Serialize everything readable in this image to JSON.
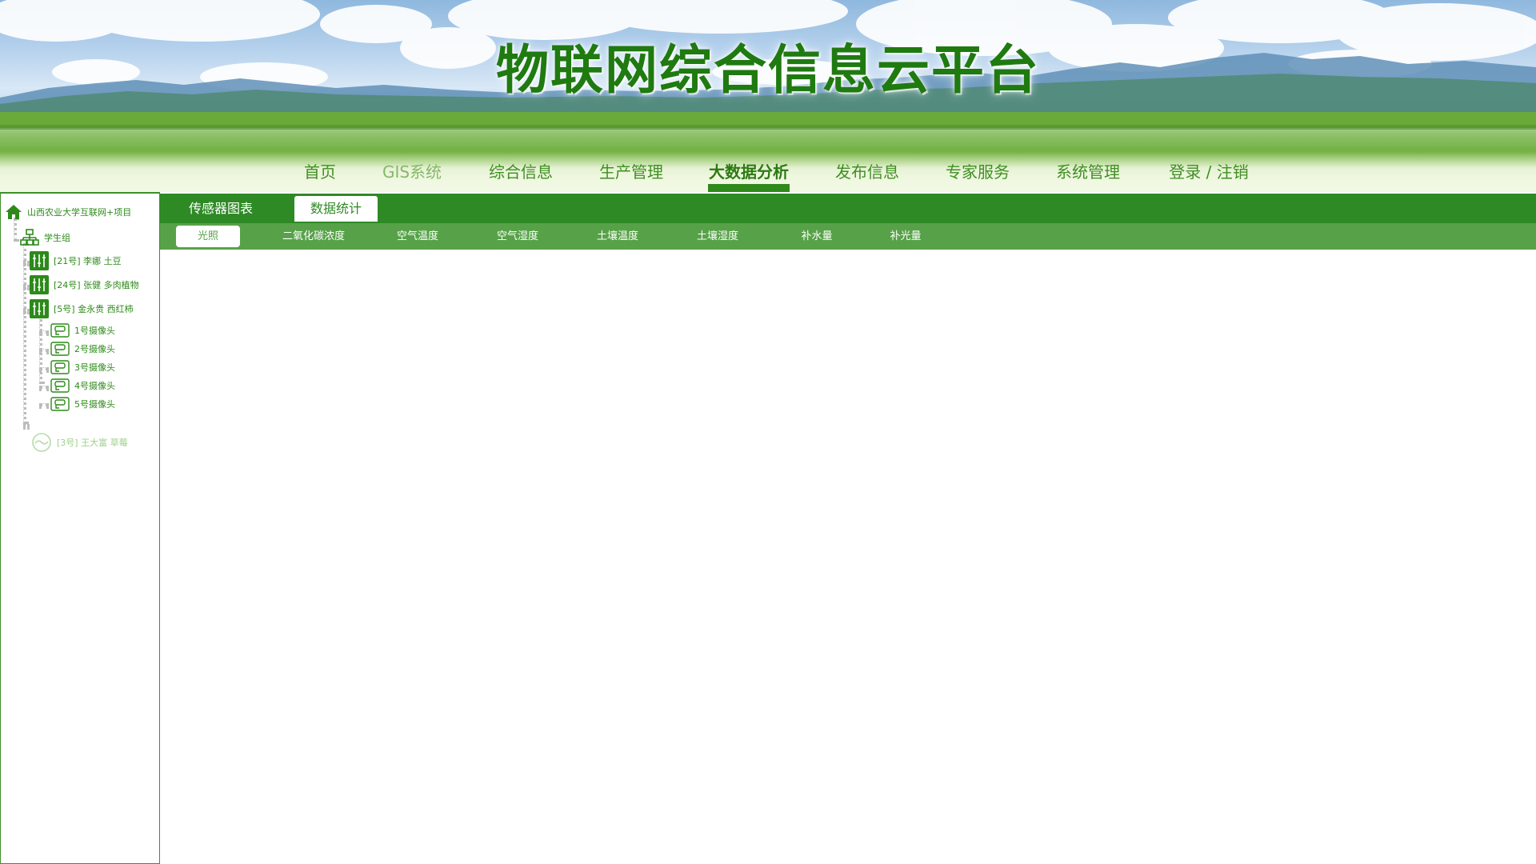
{
  "header": {
    "title": "物联网综合信息云平台"
  },
  "nav": {
    "items": [
      {
        "label": "首页"
      },
      {
        "label": "GIS系统"
      },
      {
        "label": "综合信息"
      },
      {
        "label": "生产管理"
      },
      {
        "label": "大数据分析"
      },
      {
        "label": "发布信息"
      },
      {
        "label": "专家服务"
      },
      {
        "label": "系统管理"
      },
      {
        "label": "登录 / 注销"
      }
    ],
    "active": "大数据分析"
  },
  "tree": {
    "root": "山西农业大学互联网+项目",
    "group": "学生组",
    "nodes": [
      {
        "label": "[21号] 李娜 土豆"
      },
      {
        "label": "[24号] 张健 多肉植物"
      },
      {
        "label": "[5号] 金永贵 西红柿"
      }
    ],
    "cameras": [
      {
        "label": "1号摄像头"
      },
      {
        "label": "2号摄像头"
      },
      {
        "label": "3号摄像头"
      },
      {
        "label": "4号摄像头"
      },
      {
        "label": "5号摄像头"
      }
    ],
    "offline_node": "[3号] 王大富 草莓"
  },
  "tabs_primary": {
    "items": [
      {
        "label": "传感器图表"
      },
      {
        "label": "数据统计"
      }
    ],
    "active": "数据统计"
  },
  "tabs_secondary": {
    "items": [
      {
        "label": "光照"
      },
      {
        "label": "二氧化碳浓度"
      },
      {
        "label": "空气温度"
      },
      {
        "label": "空气湿度"
      },
      {
        "label": "土壤温度"
      },
      {
        "label": "土壤湿度"
      },
      {
        "label": "补水量"
      },
      {
        "label": "补光量"
      }
    ],
    "active": "光照"
  },
  "colors": {
    "brand_green": "#2e8a24",
    "secondary_green": "#57a248",
    "title_green": "#1f7a10"
  }
}
